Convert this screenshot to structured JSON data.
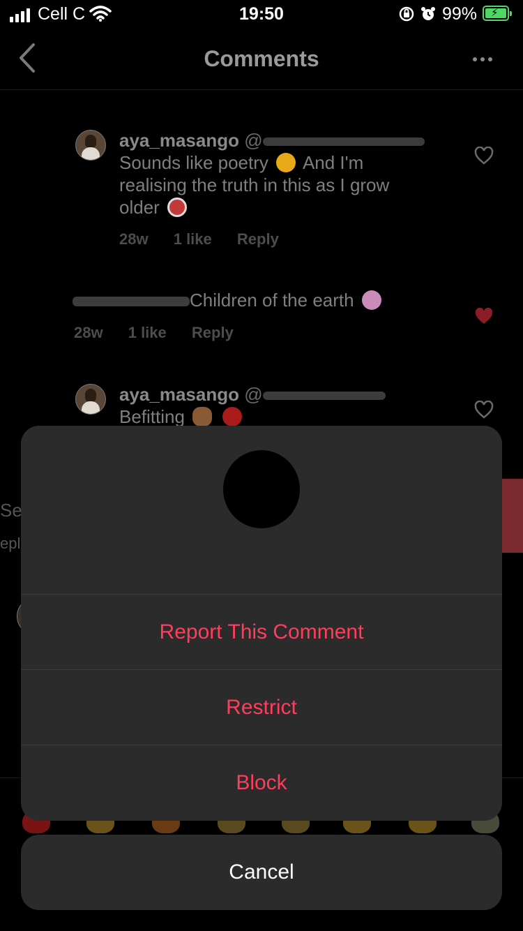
{
  "status_bar": {
    "carrier": "Cell C",
    "time": "19:50",
    "battery_percent": "99%",
    "battery_color": "#4cd964"
  },
  "header": {
    "title": "Comments",
    "back_icon": "chevron-left-icon",
    "more_icon": "more-horizontal-icon"
  },
  "comments": [
    {
      "username": "aya_masango",
      "mention": "@",
      "text_1": "Sounds like poetry",
      "text_2": "And I'm",
      "text_3": "realising the truth in this as I grow",
      "text_4": "older",
      "age": "28w",
      "likes": "1 like",
      "reply": "Reply",
      "liked": false
    },
    {
      "text": "Children of the earth",
      "age": "28w",
      "likes": "1 like",
      "reply": "Reply",
      "liked": true
    },
    {
      "username": "aya_masango",
      "mention": "@",
      "text": "Befitting",
      "liked": false
    }
  ],
  "background_fragments": {
    "left_1": "Se",
    "left_2": "epl"
  },
  "action_sheet": {
    "report": "Report This Comment",
    "restrict": "Restrict",
    "block": "Block",
    "cancel": "Cancel",
    "accent_color": "#ff3d5c"
  }
}
